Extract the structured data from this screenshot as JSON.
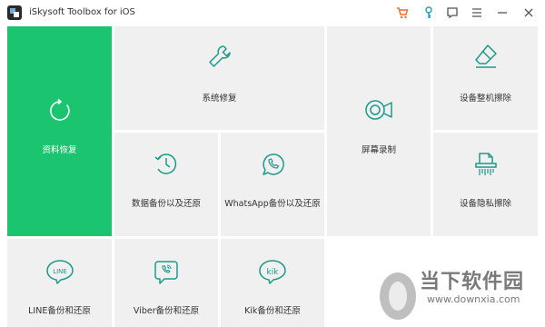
{
  "window": {
    "title": "iSkysoft Toolbox for iOS"
  },
  "toolbar_icons": [
    "cart-icon",
    "key-icon",
    "feedback-icon",
    "menu-icon",
    "minimize-icon",
    "close-icon"
  ],
  "accent_color": "#1bc570",
  "tiles": {
    "data_recovery": "资料恢复",
    "system_repair": "系统修复",
    "screen_recorder": "屏幕录制",
    "full_erase": "设备整机擦除",
    "data_backup": "数据备份以及还原",
    "whatsapp_backup": "WhatsApp备份以及还原",
    "private_erase": "设备隐私擦除",
    "line_backup": "LINE备份和还原",
    "viber_backup": "Viber备份和还原",
    "kik_backup": "Kik备份和还原"
  },
  "watermark": {
    "text": "当下软件园",
    "url": "www.downxia.com"
  }
}
